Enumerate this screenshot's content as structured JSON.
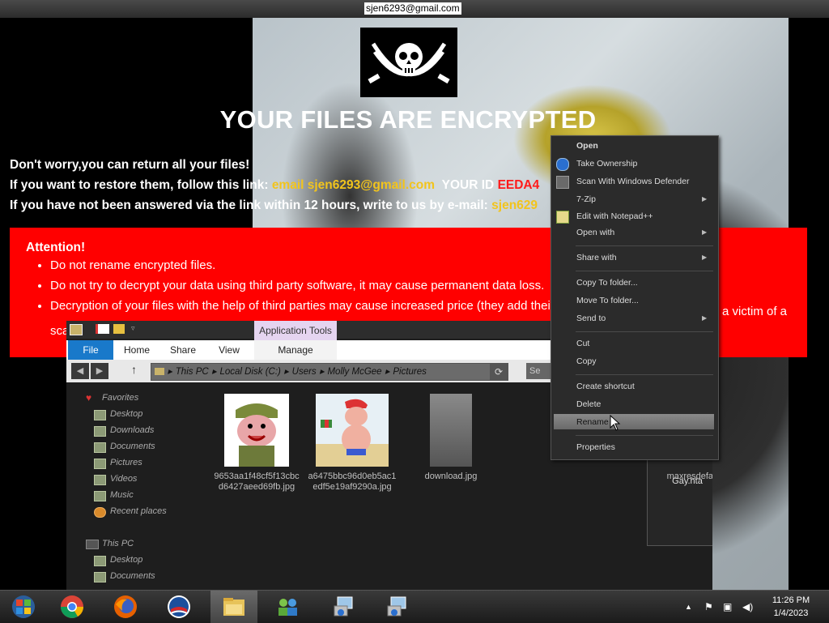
{
  "window_title": "sjen6293@gmail.com",
  "ransom": {
    "headline": "YOUR FILES ARE ENCRYPTED",
    "line1": "Don't worry,you can return all your files!",
    "line2_prefix": "If you want to restore them, follow this link:",
    "line2_email": "email sjen6293@gmail.com",
    "line2_id_label": "YOUR ID",
    "line2_id_value": "EEDA4",
    "line3_prefix": "If you have not been answered via the link within 12 hours, write to us by e-mail:",
    "line3_email": "sjen629",
    "attention_title": "Attention!",
    "bullets": [
      "Do not rename encrypted files.",
      "Do not try to decrypt your data using third party software, it may cause permanent data loss.",
      "Decryption of your files with the help of third parties may cause increased price (they add their"
    ],
    "bullet3_tail": "a victim of a",
    "bullet3_cont": "sca"
  },
  "explorer": {
    "context_tab": "Application Tools",
    "ribbon_tabs": [
      "File",
      "Home",
      "Share",
      "View",
      "Manage"
    ],
    "breadcrumb": [
      "This PC",
      "Local Disk (C:)",
      "Users",
      "Molly McGee",
      "Pictures"
    ],
    "search_placeholder": "Se",
    "nav": {
      "favorites": "Favorites",
      "fav_items": [
        "Desktop",
        "Downloads",
        "Documents",
        "Pictures",
        "Videos",
        "Music",
        "Recent places"
      ],
      "this_pc": "This PC",
      "pc_items": [
        "Desktop",
        "Documents"
      ]
    },
    "files": [
      {
        "name": "9653aa1f48cf5f13cbcd6427aeed69fb.jpg"
      },
      {
        "name": "a6475bbc96d0eb5ac1edf5e19af9290a.jpg"
      },
      {
        "name": "download.jpg"
      },
      {
        "name": "Gay.hta"
      },
      {
        "name": "maxresdefault.jpg"
      }
    ]
  },
  "context_menu": {
    "open": "Open",
    "take_ownership": "Take Ownership",
    "scan": "Scan With Windows Defender",
    "zip": "7-Zip",
    "notepad": "Edit with Notepad++",
    "open_with": "Open with",
    "share_with": "Share with",
    "copy_to": "Copy To folder...",
    "move_to": "Move To folder...",
    "send_to": "Send to",
    "cut": "Cut",
    "copy": "Copy",
    "create_shortcut": "Create shortcut",
    "delete": "Delete",
    "rename": "Rename",
    "properties": "Properties"
  },
  "taskbar": {
    "apps": [
      "start-orb-icon",
      "chrome-icon",
      "firefox-icon",
      "obama-logo-icon",
      "file-explorer-icon",
      "network-users-icon",
      "installer-icon",
      "installer-icon-2"
    ],
    "time": "11:26 PM",
    "date": "1/4/2023"
  },
  "colors": {
    "accent_red": "#ff0000",
    "accent_yellow": "#f2c41c",
    "file_tab_blue": "#1979ca"
  }
}
